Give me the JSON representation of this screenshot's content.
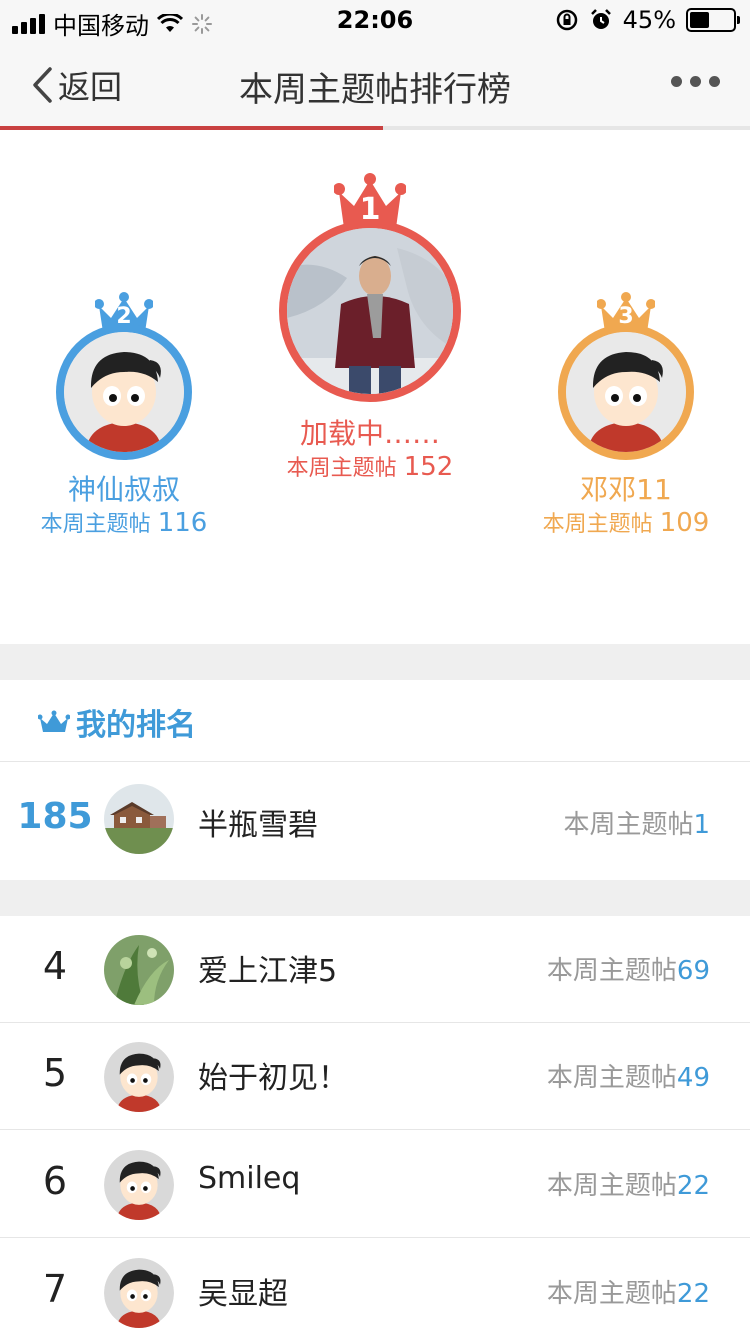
{
  "status_bar": {
    "carrier": "中国移动",
    "time": "22:06",
    "battery": "45%",
    "battery_level": 0.45
  },
  "nav": {
    "back_label": "返回",
    "title": "本周主题帖排行榜",
    "progress": 0.51
  },
  "podium": {
    "first": {
      "rank": "1",
      "name": "加载中……",
      "label": "本周主题帖",
      "count": "152"
    },
    "second": {
      "rank": "2",
      "name": "神仙叔叔",
      "label": "本周主题帖",
      "count": "116"
    },
    "third": {
      "rank": "3",
      "name": "邓邓11",
      "label": "本周主题帖",
      "count": "109"
    }
  },
  "my_rank": {
    "title": "我的排名",
    "rank": "185",
    "name": "半瓶雪碧",
    "label": "本周主题帖",
    "count": "1"
  },
  "list": [
    {
      "rank": "4",
      "name": "爱上江津5",
      "label": "本周主题帖",
      "count": "69",
      "avatar": "plant"
    },
    {
      "rank": "5",
      "name": "始于初见！",
      "label": "本周主题帖",
      "count": "49",
      "avatar": "cartoon"
    },
    {
      "rank": "6",
      "name": "Smileq",
      "label": "本周主题帖",
      "count": "22",
      "avatar": "cartoon"
    },
    {
      "rank": "7",
      "name": "吴显超",
      "label": "本周主题帖",
      "count": "22",
      "avatar": "cartoon"
    }
  ],
  "colors": {
    "gold_red": "#e85a50",
    "blue": "#4a9fe0",
    "orange": "#f0a850",
    "accent_text": "#3f9ad8"
  },
  "icons": {
    "back": "chevron-left-icon",
    "more": "more-dots-icon",
    "crown": "crown-icon",
    "wifi": "wifi-icon",
    "lock": "orientation-lock-icon",
    "alarm": "alarm-icon"
  }
}
